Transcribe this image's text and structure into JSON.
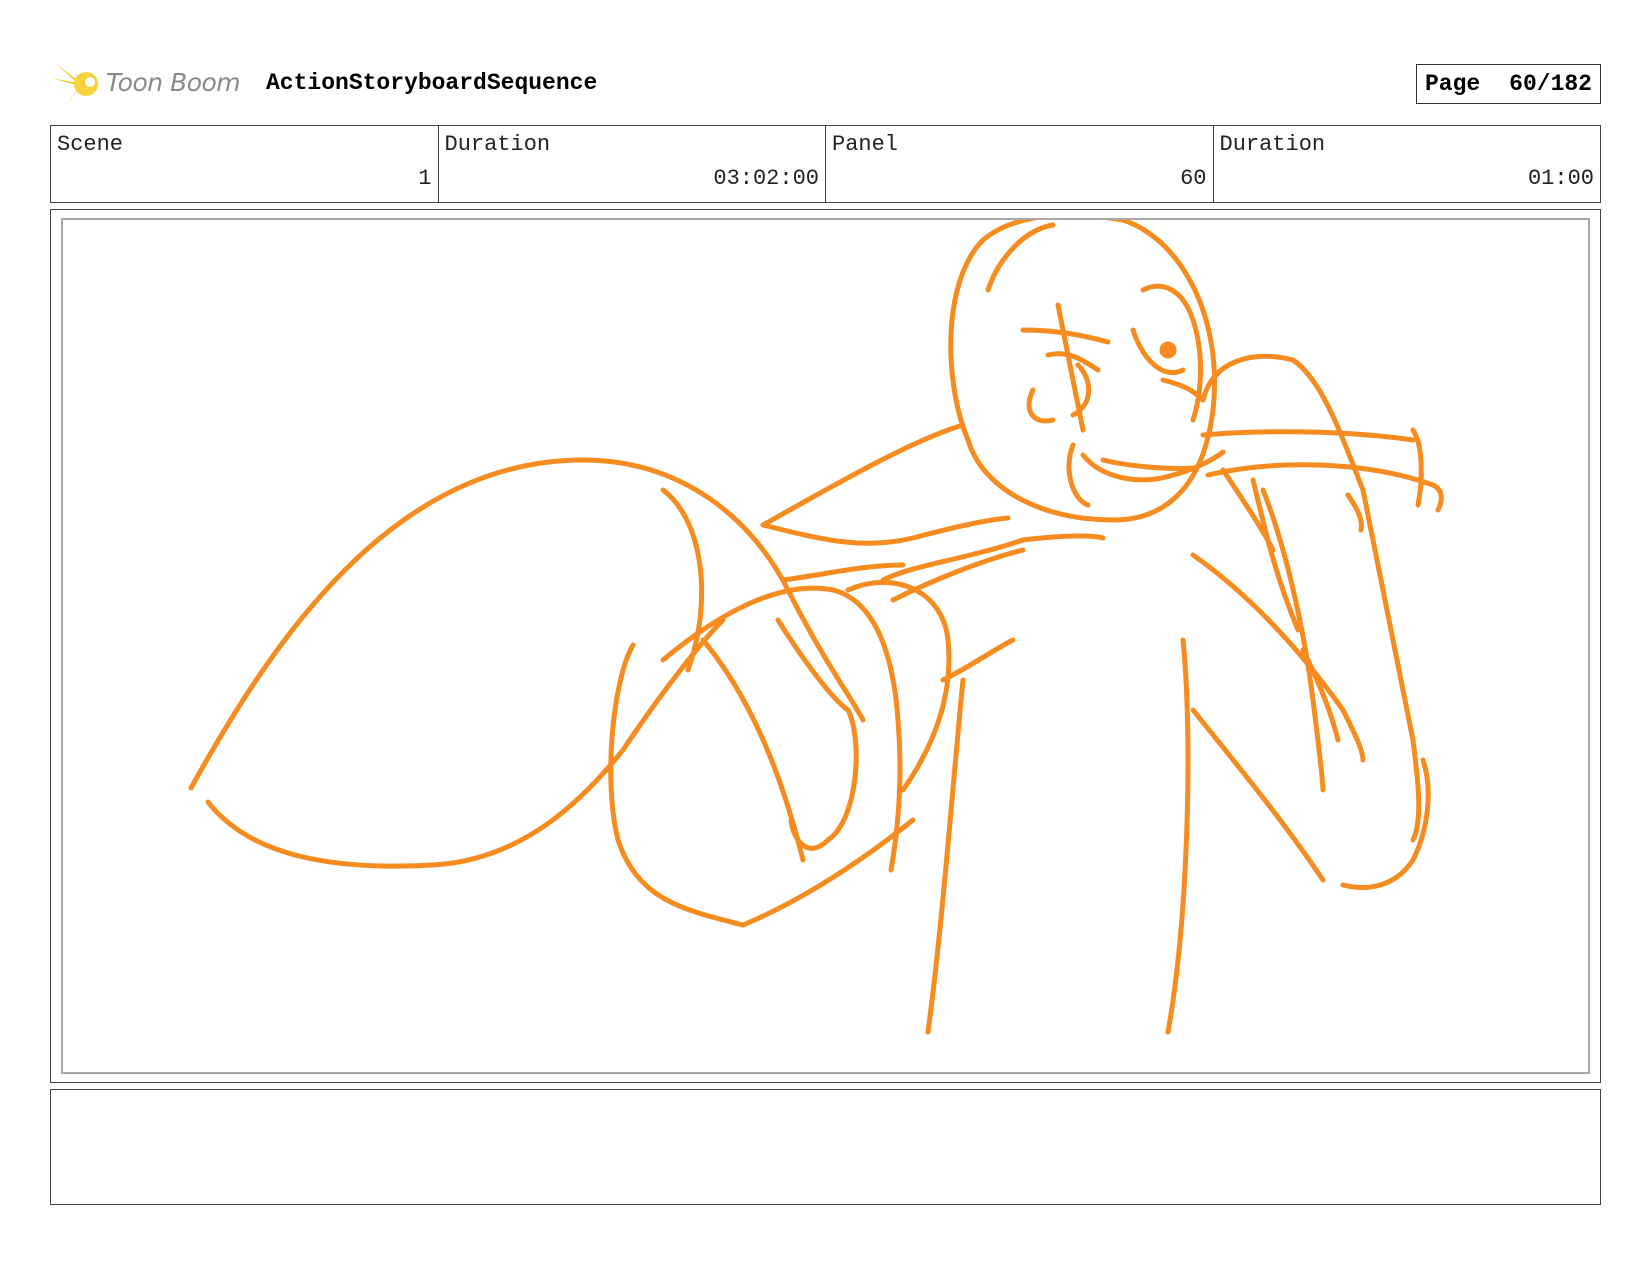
{
  "header": {
    "logo_text": "Toon Boom",
    "sequence_title": "ActionStoryboardSequence",
    "page_label": "Page",
    "page_value": "60/182"
  },
  "info": {
    "scene_label": "Scene",
    "scene_value": "1",
    "scene_duration_label": "Duration",
    "scene_duration_value": "03:02:00",
    "panel_label": "Panel",
    "panel_value": "60",
    "panel_duration_label": "Duration",
    "panel_duration_value": "01:00"
  },
  "colors": {
    "sketch": "#f68b1f",
    "logo_burst": "#f5c518",
    "logo_text": "#8a8a8a"
  },
  "icons": {
    "logo": "toon-boom-burst-icon"
  }
}
